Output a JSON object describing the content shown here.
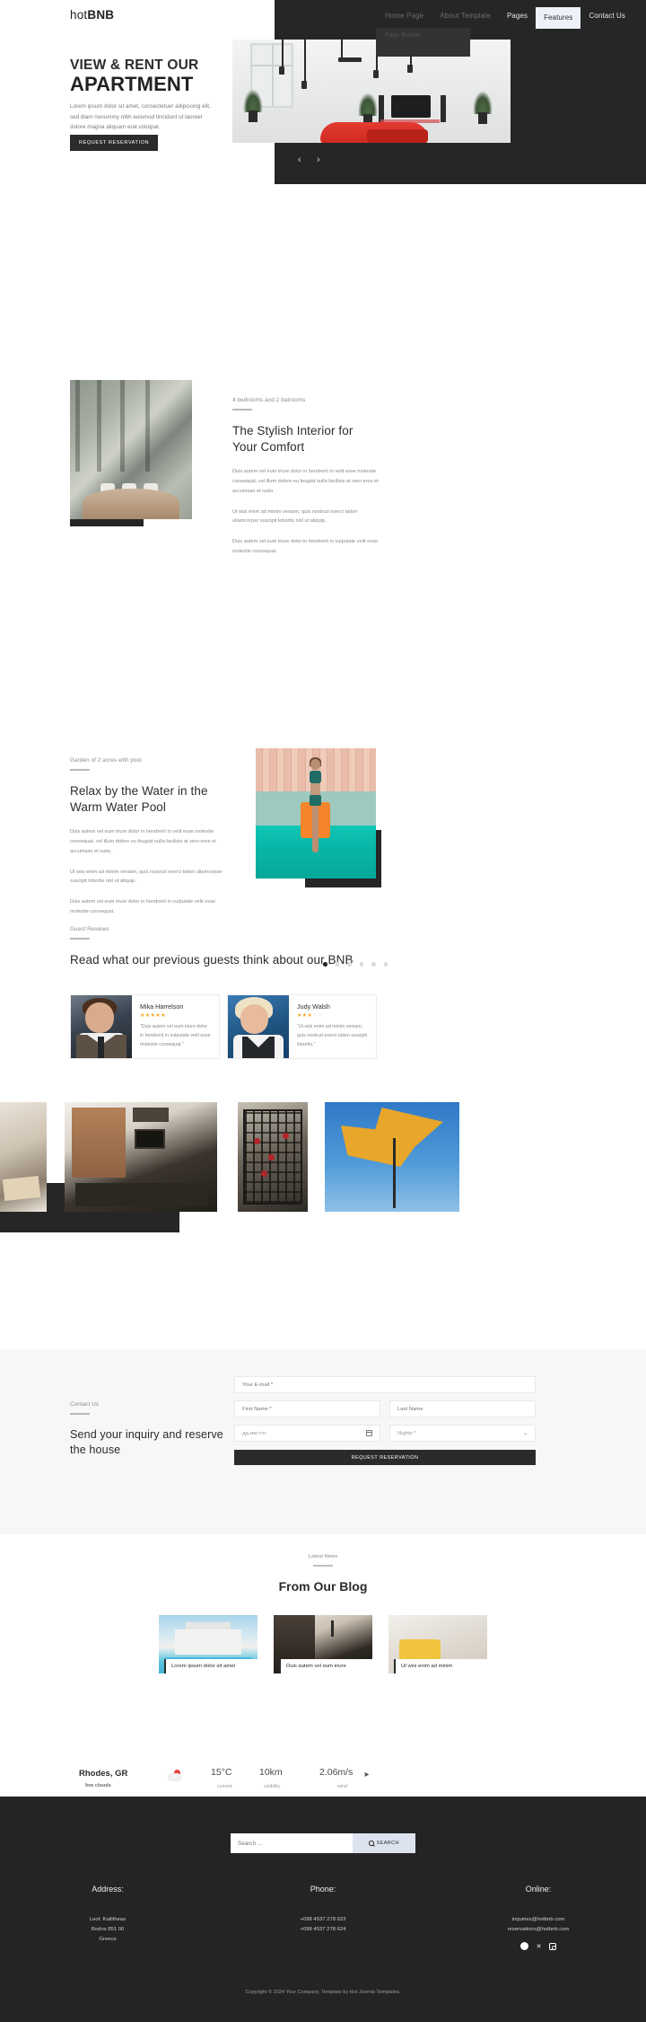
{
  "header": {
    "logo_light": "hot",
    "logo_bold": "BNB",
    "nav": [
      {
        "label": "Home Page"
      },
      {
        "label": "About Template"
      },
      {
        "label": "Pages"
      },
      {
        "label": "Features"
      },
      {
        "label": "Contact Us"
      }
    ],
    "dropdown": {
      "items": [
        {
          "label": "Page Builder"
        }
      ]
    }
  },
  "hero": {
    "title_top": "VIEW & RENT OUR",
    "title_main": "APARTMENT",
    "paragraph": "Lorem ipsum dolor sit amet, consectetuer adipiscing elit, sed diam nonummy nibh euismod tincidunt ut laoreet dolore magna aliquam erat volutpat.",
    "cta": "REQUEST RESERVATION",
    "prev_arrow": "‹",
    "next_arrow": "›"
  },
  "interior": {
    "eyebrow": "4 bedrooms and 2 batrooms",
    "title": "The Stylish Interior for Your Comfort",
    "p1": "Duis autem vel eum iriure dolor in hendrerit in velit esse molestie consequat, vel illum dolore eu feugiat nulla facilisis at vero eros et accumsan et iusto.",
    "p2": "Ut wisi enim ad minim veniam, quis nostrud exerci tation ullamcorper suscipit lobortis nisl ut aliquip.",
    "p3": "Duis autem vel eum iriure dolor in hendrerit in vulputate velit esse molestie consequat."
  },
  "pool": {
    "eyebrow": "Garden of 2 acres with pool",
    "title": "Relax by the Water in the Warm Water Pool",
    "p1": "Duis autem vel eum iriure dolor in hendrerit in velit esse molestie consequat, vel illum dolore eu feugiat nulla facilisis at vero eros et accumsan et iusto.",
    "p2": "Ut wisi enim ad minim veniam, quis nostrud exerci tation ullamcorper suscipit lobortis nisl ut aliquip.",
    "p3": "Duis autem vel eum iriure dolor in hendrerit in vulputate velit esse molestie consequat."
  },
  "reviews": {
    "eyebrow": "Guest Reviews",
    "title": "Read what our previous guests think about our BNB",
    "dots": 6,
    "active_dot": 0,
    "items": [
      {
        "name": "Mika Harrelson",
        "rating": 5,
        "stars_on": "★★★★★",
        "stars_off": "",
        "quote": "“Duis autem vel eum iriure dolor in hendrerit in vulputate velit esse molestie consequat.”"
      },
      {
        "name": "Judy Walsh",
        "rating": 3,
        "stars_on": "★★★",
        "stars_off": "☆☆",
        "quote": "“Ut wisi enim ad minim veniam, quis nostrud exerci tation suscipit lobortis.”"
      }
    ]
  },
  "weather": {
    "city": "Rhodes, GR",
    "condition": "few clouds",
    "metrics": [
      {
        "value": "15°C",
        "label": "current"
      },
      {
        "value": "10km",
        "label": "visibility"
      },
      {
        "value": "2.06m/s",
        "label": "wind"
      }
    ],
    "wind_arrow": "➤"
  },
  "contact": {
    "eyebrow": "Contact Us",
    "title": "Send your inquiry and reserve the house",
    "email_placeholder": "Your E-mail *",
    "first_name_placeholder": "First Name *",
    "last_name_placeholder": "Last Name",
    "date_placeholder": "дд.мм.гггг",
    "nights_placeholder": "Nights *",
    "submit": "REQUEST RESERVATION"
  },
  "blog": {
    "eyebrow": "Latest News",
    "title": "From Our Blog",
    "posts": [
      {
        "title": "Lorem ipsum dolor sit amet"
      },
      {
        "title": "Duis autem vel eum iriure"
      },
      {
        "title": "Ut wisi enim ad minim"
      }
    ]
  },
  "footer": {
    "search_placeholder": "Search ...",
    "search_button": "SEARCH",
    "columns": [
      {
        "heading": "Address:",
        "lines": "Leof. Kallitheas\nRodos 851 00\nGreece"
      },
      {
        "heading": "Phone:",
        "lines": "+098 4537 278 623\n+098 4537 278 624"
      },
      {
        "heading": "Online:",
        "lines": "inquiries@hotbnb.com\nreservations@hotbnb.com"
      }
    ],
    "social": [
      {
        "name": "facebook",
        "glyph": "f"
      },
      {
        "name": "x-twitter",
        "glyph": "✕"
      },
      {
        "name": "instagram",
        "glyph": ""
      }
    ],
    "copyright": "Copyright © 2024 Your Company. Template by Hot Joomla Templates."
  },
  "colors": {
    "dark": "#262626",
    "accent_star": "#f5a623",
    "light_bg": "#f7f7f7",
    "nav_active_bg": "#eef2f8"
  }
}
